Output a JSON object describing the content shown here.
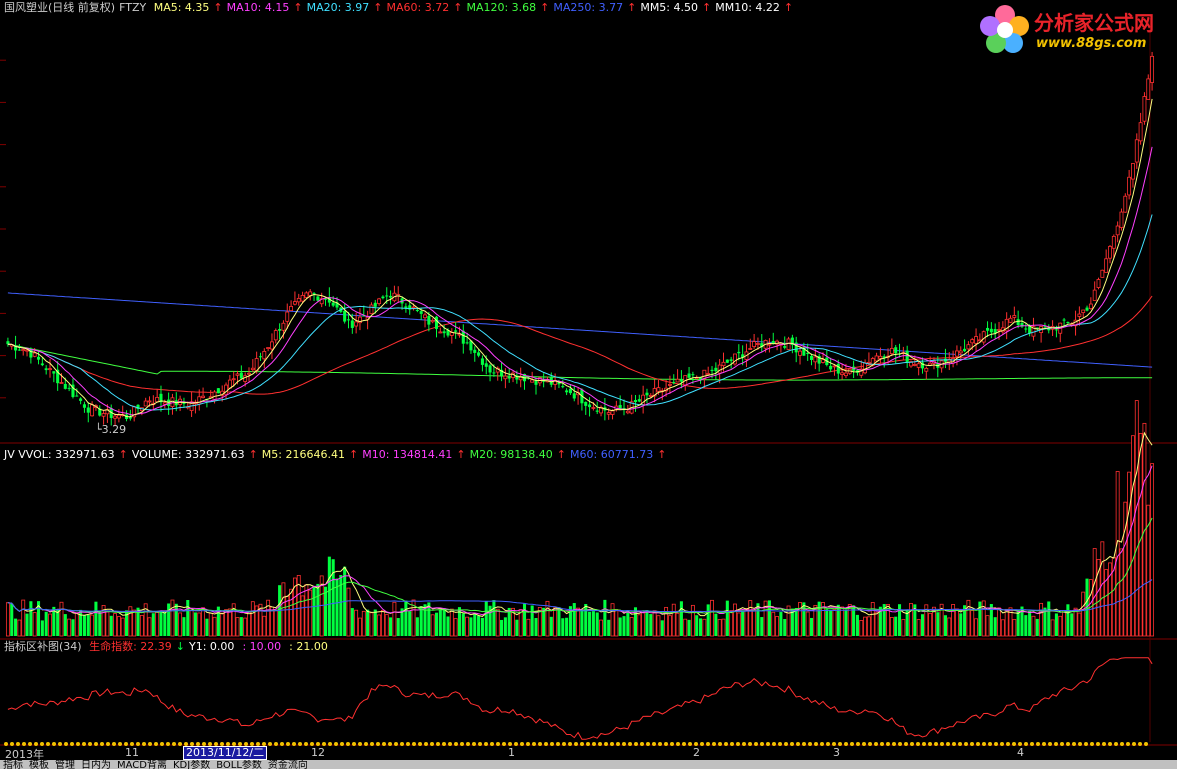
{
  "main_header": {
    "title": "国风塑业(日线 前复权)",
    "indicator": "FTZY",
    "items": [
      {
        "label": "MA5: 4.35",
        "color": "#ffff80",
        "arrow": "↑"
      },
      {
        "label": "MA10: 4.15",
        "color": "#ff40ff",
        "arrow": "↑"
      },
      {
        "label": "MA20: 3.97",
        "color": "#40e0ff",
        "arrow": "↑"
      },
      {
        "label": "MA60: 3.72",
        "color": "#ff3030",
        "arrow": "↑"
      },
      {
        "label": "MA120: 3.68",
        "color": "#40ff40",
        "arrow": "↑"
      },
      {
        "label": "MA250: 3.77",
        "color": "#4060ff",
        "arrow": "↑"
      },
      {
        "label": "MM5: 4.50",
        "color": "#ffffff",
        "arrow": "↑"
      },
      {
        "label": "MM10: 4.22",
        "color": "#ffffff",
        "arrow": "↑"
      }
    ]
  },
  "volume_header": {
    "items": [
      {
        "label": "JV VVOL: 332971.63",
        "color": "#ffffff",
        "arrow": "↑"
      },
      {
        "label": "VOLUME: 332971.63",
        "color": "#ffffff",
        "arrow": "↑"
      },
      {
        "label": "M5: 216646.41",
        "color": "#ffff80",
        "arrow": "↑"
      },
      {
        "label": "M10: 134814.41",
        "color": "#ff40ff",
        "arrow": "↑"
      },
      {
        "label": "M20: 98138.40",
        "color": "#40ff40",
        "arrow": "↑"
      },
      {
        "label": "M60: 60771.73",
        "color": "#4060ff",
        "arrow": "↑"
      }
    ]
  },
  "indicator_header": {
    "title": "指标区补图(34)",
    "items": [
      {
        "label": "生命指数: 22.39",
        "color": "#ff3030",
        "arrow": "↓"
      },
      {
        "label": "Y1: 0.00",
        "color": "#ffffff",
        "arrow": ""
      },
      {
        "label": ": 10.00",
        "color": "#ff40ff",
        "arrow": ""
      },
      {
        "label": ": 21.00",
        "color": "#ffff80",
        "arrow": ""
      }
    ]
  },
  "low_marker": "3.29",
  "logo": {
    "name": "分析家公式网",
    "url": "www.88gs.com"
  },
  "x_axis": {
    "labels": [
      {
        "text": "2013年",
        "pos": 0.004
      },
      {
        "text": "11",
        "pos": 0.106
      },
      {
        "text": "12",
        "pos": 0.264
      },
      {
        "text": "1",
        "pos": 0.432
      },
      {
        "text": "2",
        "pos": 0.589
      },
      {
        "text": "3",
        "pos": 0.708
      },
      {
        "text": "4",
        "pos": 0.864
      }
    ],
    "cursor_date": "2013/11/12/二"
  },
  "bottom_tabs": [
    "指标",
    "模板",
    "管理",
    "日内为",
    "MACD背离",
    "KDJ参数",
    "BOLL参数",
    "资金流向"
  ],
  "colors": {
    "up": "#ff3030",
    "down": "#00ff40",
    "ma5": "#ffff80",
    "ma10": "#ff40ff",
    "ma20": "#40e0ff",
    "ma60": "#ff3030",
    "ma120": "#40ff40",
    "ma250": "#4060ff"
  },
  "chart_data": {
    "type": "candlestick",
    "price_range_approx": [
      3.2,
      6.5
    ],
    "key_prices": {
      "low": 3.29,
      "ma5": 4.35,
      "ma10": 4.15,
      "ma20": 3.97,
      "ma60": 3.72,
      "ma120": 3.68,
      "ma250": 3.77
    },
    "close_profile": [
      3.95,
      3.9,
      3.75,
      3.6,
      3.45,
      3.4,
      3.38,
      3.52,
      3.5,
      3.48,
      3.55,
      3.65,
      3.72,
      3.95,
      4.2,
      4.35,
      4.3,
      4.1,
      4.2,
      4.35,
      4.25,
      4.12,
      4.05,
      3.95,
      3.75,
      3.72,
      3.68,
      3.65,
      3.58,
      3.48,
      3.42,
      3.46,
      3.55,
      3.62,
      3.68,
      3.72,
      3.82,
      3.92,
      3.98,
      3.95,
      3.85,
      3.76,
      3.72,
      3.84,
      3.9,
      3.82,
      3.78,
      3.85,
      3.95,
      4.05,
      4.15,
      4.05,
      4.08,
      4.12,
      4.28,
      4.75,
      5.3,
      6.2
    ],
    "volume_unit": "shares",
    "volume_last": 332971.63,
    "indicator_last": 22.39,
    "indicator_levels": [
      10.0,
      21.0
    ]
  }
}
